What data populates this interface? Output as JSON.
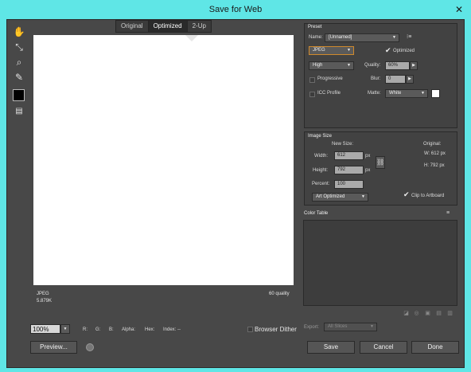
{
  "window": {
    "title": "Save for Web"
  },
  "tabs": [
    "Original",
    "Optimized",
    "2-Up"
  ],
  "preview_info": {
    "format": "JPEG",
    "size": "5.879K",
    "quality": "60 quality"
  },
  "bottom_bar": {
    "zoom": "100%",
    "r": "R:",
    "g": "G:",
    "b": "B:",
    "alpha": "Alpha:",
    "hex": "Hex:",
    "index": "Index: --",
    "browser_dither": "Browser Dither",
    "preview_button": "Preview..."
  },
  "preset": {
    "title": "Preset",
    "name_label": "Name:",
    "name_value": "[Unnamed]",
    "format": "JPEG",
    "optimized_label": "Optimized",
    "compression": "High",
    "quality_label": "Quality:",
    "quality_value": "60%",
    "progressive_label": "Progressive",
    "blur_label": "Blur:",
    "blur_value": "0",
    "icc_label": "ICC Profile",
    "matte_label": "Matte:",
    "matte_value": "White",
    "matte_color": "#ffffff"
  },
  "image_size": {
    "title": "Image Size",
    "new_size_label": "New Size:",
    "width_label": "Width:",
    "width_value": "612",
    "height_label": "Height:",
    "height_value": "792",
    "px": "px",
    "percent_label": "Percent:",
    "percent_value": "100",
    "resample": "Art Optimized",
    "clip_label": "Clip to Artboard",
    "original_label": "Original:",
    "orig_w": "W:  612 px",
    "orig_h": "H:  792 px"
  },
  "color_table": {
    "title": "Color Table"
  },
  "export": {
    "label": "Export:",
    "value": "All Slices"
  },
  "buttons": {
    "save": "Save",
    "cancel": "Cancel",
    "done": "Done"
  }
}
